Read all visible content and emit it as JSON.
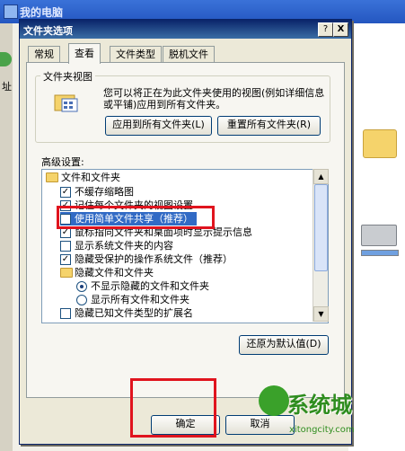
{
  "background_window": {
    "title": "我的电脑",
    "address_label": "址"
  },
  "dialog": {
    "title": "文件夹选项",
    "help_label": "?",
    "close_label": "X"
  },
  "tabs": [
    {
      "label": "常规",
      "selected": false
    },
    {
      "label": "查看",
      "selected": true
    },
    {
      "label": "文件类型",
      "selected": false
    },
    {
      "label": "脱机文件",
      "selected": false
    }
  ],
  "folder_views": {
    "legend": "文件夹视图",
    "description": "您可以将正在为此文件夹使用的视图(例如详细信息或平铺)应用到所有文件夹。",
    "apply_all_label": "应用到所有文件夹(L)",
    "reset_all_label": "重置所有文件夹(R)"
  },
  "advanced": {
    "label": "高级设置:",
    "items": [
      {
        "text": "文件和文件夹",
        "kind": "folder",
        "checked": null
      },
      {
        "text": "不缓存缩略图",
        "kind": "checkbox",
        "checked": true
      },
      {
        "text": "记住每个文件夹的视图设置",
        "kind": "checkbox",
        "checked": true
      },
      {
        "text": "使用简单文件共享（推荐）",
        "kind": "checkbox",
        "checked": false
      },
      {
        "text": "鼠标指向文件夹和桌面项时显示提示信息",
        "kind": "checkbox",
        "checked": true
      },
      {
        "text": "显示系统文件夹的内容",
        "kind": "checkbox",
        "checked": false
      },
      {
        "text": "隐藏受保护的操作系统文件（推荐）",
        "kind": "checkbox",
        "checked": true
      },
      {
        "text": "隐藏文件和文件夹",
        "kind": "folder",
        "checked": null
      },
      {
        "text": "不显示隐藏的文件和文件夹",
        "kind": "radio",
        "checked": true
      },
      {
        "text": "显示所有文件和文件夹",
        "kind": "radio",
        "checked": false
      },
      {
        "text": "隐藏已知文件类型的扩展名",
        "kind": "checkbox",
        "checked": false
      }
    ],
    "restore_defaults_label": "还原为默认值(D)"
  },
  "buttons": {
    "ok_label": "确定",
    "cancel_label": "取消"
  },
  "watermark": {
    "text": "系统城",
    "url": "xitongcity.com"
  },
  "colors": {
    "highlight": "#e0141e",
    "title_bar": "#0a246a",
    "watermark": "#2f8d1f"
  }
}
